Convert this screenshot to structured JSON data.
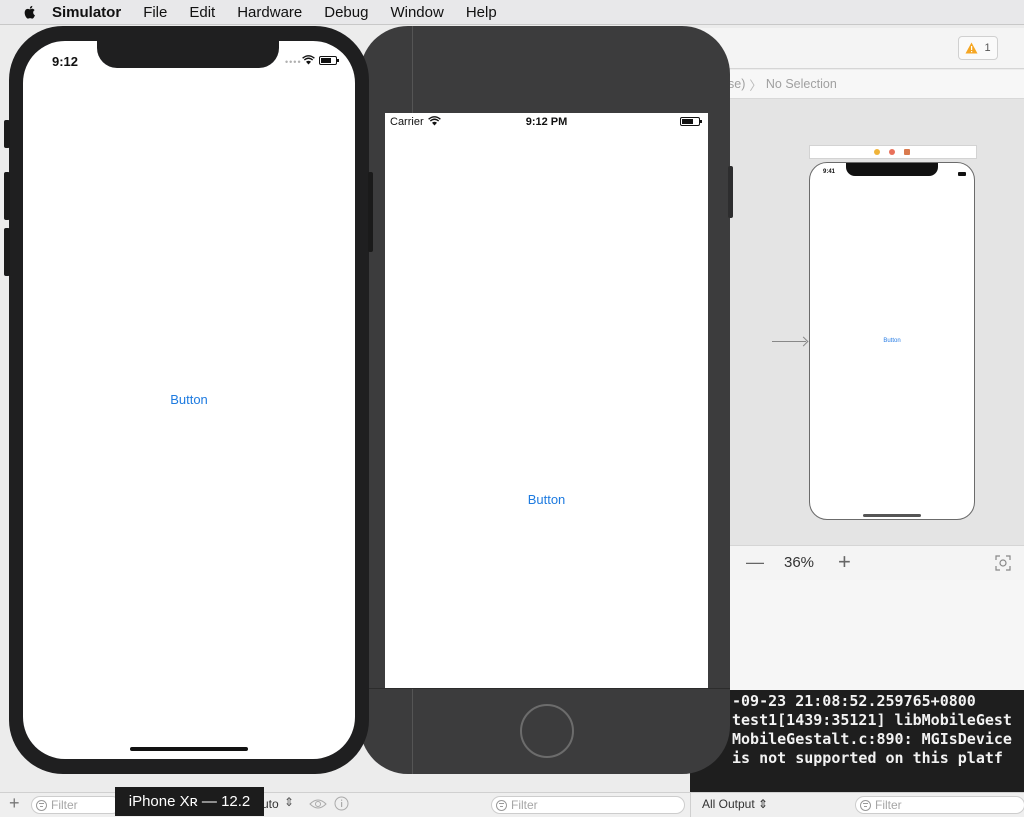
{
  "menubar": {
    "app": "Simulator",
    "items": [
      "File",
      "Edit",
      "Hardware",
      "Debug",
      "Window",
      "Help"
    ]
  },
  "xcode": {
    "warning_count": "1",
    "jumpbar_prefix": "se)",
    "jumpbar_text": "No Selection",
    "zoom_level": "36%",
    "storyboard": {
      "time": "9:41",
      "button_label": "Button",
      "scene_dot_colors": [
        "#f0b43a",
        "#e8705a",
        "#d97a4e"
      ]
    },
    "console_lines": [
      "-09-23 21:08:52.259765+0800",
      "test1[1439:35121] libMobileGest",
      "MobileGestalt.c:890: MGIsDevice",
      "is not supported on this platf"
    ],
    "bottombar": {
      "filter_placeholder_left": "Filter",
      "auto_label": "uto",
      "filter_placeholder_mid": "Filter",
      "all_output": "All Output",
      "filter_placeholder_right": "Filter"
    }
  },
  "iphone8": {
    "carrier": "Carrier",
    "time": "9:12 PM",
    "button_label": "Button"
  },
  "iphonexr": {
    "time": "9:12",
    "button_label": "Button"
  },
  "device_tooltip": "iPhone Xʀ — 12.2",
  "colors": {
    "accent": "#1e7be0",
    "console_bg": "#1e1e1e",
    "warning": "#f5a623"
  }
}
